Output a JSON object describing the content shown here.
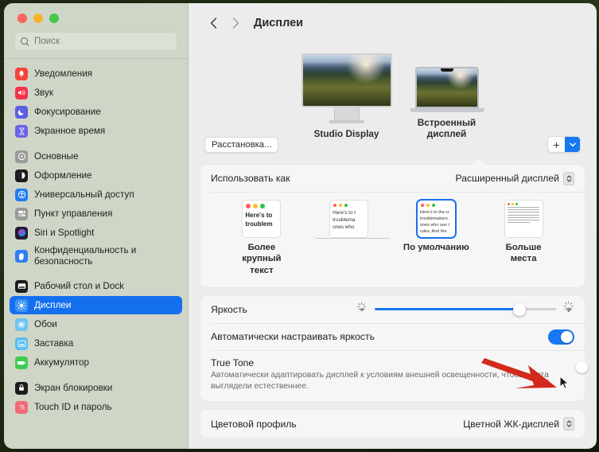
{
  "window": {
    "traffic_lights": [
      "close",
      "minimize",
      "zoom"
    ]
  },
  "sidebar": {
    "search": {
      "placeholder": "Поиск",
      "icon": "search-icon",
      "value": ""
    },
    "groups": [
      {
        "items": [
          {
            "label": "Уведомления",
            "icon": "notifications-icon",
            "color": "#f5453a",
            "glyph": "🔔"
          },
          {
            "label": "Звук",
            "icon": "sound-icon",
            "color": "#f5334a",
            "glyph": "🔊"
          },
          {
            "label": "Фокусирование",
            "icon": "focus-icon",
            "color": "#5b5fe0",
            "glyph": "🌙"
          },
          {
            "label": "Экранное время",
            "icon": "screen-time-icon",
            "color": "#6a63e8",
            "glyph": "⏳"
          }
        ]
      },
      {
        "items": [
          {
            "label": "Основные",
            "icon": "general-icon",
            "color": "#9a9a9a",
            "glyph": "⚙"
          },
          {
            "label": "Оформление",
            "icon": "appearance-icon",
            "color": "#1c1c1c",
            "glyph": "◐"
          },
          {
            "label": "Универсальный доступ",
            "icon": "accessibility-icon",
            "color": "#1f7df5",
            "glyph": "♿"
          },
          {
            "label": "Пункт управления",
            "icon": "control-center-icon",
            "color": "#9a9a9a",
            "glyph": "▤"
          },
          {
            "label": "Siri и Spotlight",
            "icon": "siri-icon",
            "color": "#3a2a52",
            "glyph": "◉"
          },
          {
            "label": "Конфиденциальность и безопасность",
            "icon": "privacy-icon",
            "color": "#2f7df6",
            "glyph": "✋"
          }
        ]
      },
      {
        "items": [
          {
            "label": "Рабочий стол и Dock",
            "icon": "desktop-dock-icon",
            "color": "#1c1c1c",
            "glyph": "▤"
          },
          {
            "label": "Дисплеи",
            "icon": "displays-icon",
            "color": "#3d93f5",
            "glyph": "☀",
            "selected": true
          },
          {
            "label": "Обои",
            "icon": "wallpaper-icon",
            "color": "#6cc4f2",
            "glyph": "❋"
          },
          {
            "label": "Заставка",
            "icon": "screensaver-icon",
            "color": "#59bdf0",
            "glyph": "▣"
          },
          {
            "label": "Аккумулятор",
            "icon": "battery-icon",
            "color": "#3dcc51",
            "glyph": "▬"
          }
        ]
      },
      {
        "items": [
          {
            "label": "Экран блокировки",
            "icon": "lock-screen-icon",
            "color": "#1c1c1c",
            "glyph": "🔒"
          },
          {
            "label": "Touch ID и пароль",
            "icon": "touch-id-icon",
            "color": "#f06a78",
            "glyph": "◉"
          }
        ]
      }
    ]
  },
  "header": {
    "back_icon": "chevron-left-icon",
    "forward_icon": "chevron-right-icon",
    "title": "Дисплеи"
  },
  "displays": {
    "items": [
      {
        "label": "Studio Display",
        "type": "monitor"
      },
      {
        "label": "Встроенный дисплей",
        "type": "laptop",
        "selected": true
      }
    ],
    "arrange_button": "Расстановка...",
    "add_button_icon": "plus-icon",
    "add_menu_icon": "chevron-down-icon"
  },
  "use_as": {
    "label": "Использовать как",
    "selected_value": "Расширенный дисплей",
    "popup_icon": "updown-chevron-icon",
    "presets": [
      {
        "label": "Более крупный текст",
        "selected": false,
        "preview": "Here's to the troublem"
      },
      {
        "label": "",
        "selected": false,
        "preview": "Here's to t\ntroublema\nones who"
      },
      {
        "label": "По умолчанию",
        "selected": true,
        "preview": "Here's to the cr\ntroublemakers.\nones who see t\nrules. And the"
      },
      {
        "label": "Больше места",
        "selected": false,
        "preview": "dense"
      }
    ]
  },
  "brightness": {
    "label": "Яркость",
    "value_percent": 80,
    "min_icon": "brightness-low-icon",
    "max_icon": "brightness-high-icon"
  },
  "auto_brightness": {
    "label": "Автоматически настраивать яркость",
    "enabled": true,
    "state": "on"
  },
  "true_tone": {
    "label": "True Tone",
    "description": "Автоматически адаптировать дисплей к условиям внешней освещенности, чтобы цвета выглядели естественнее.",
    "enabled": false,
    "state": "off"
  },
  "color_profile": {
    "label": "Цветовой профиль",
    "selected_value": "Цветной ЖК-дисплей",
    "popup_icon": "updown-chevron-icon"
  },
  "annotation": {
    "arrow_color": "#d32a1e",
    "points_to": "true-tone-toggle",
    "cursor_icon": "arrow-cursor"
  }
}
